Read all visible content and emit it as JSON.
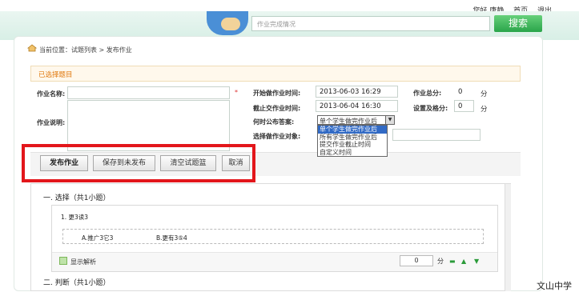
{
  "topbar": {
    "greeting": "您好,唐静",
    "home": "首页",
    "logout": "退出"
  },
  "search": {
    "placeholder": "作业完成情况",
    "button": "搜索"
  },
  "breadcrumb": "当前位置：试题列表 > 发布作业",
  "section_title": "已选择题目",
  "form": {
    "name_label": "作业名称:",
    "desc_label": "作业说明:",
    "star": "*",
    "start_label": "开始做作业时间:",
    "start_value": "2013-06-03 16:29",
    "end_label": "截止交作业时间:",
    "end_value": "2013-06-04 16:30",
    "publish_label": "何时公布答案:",
    "publish_selected": "单个学生做完作业后",
    "target_label": "选择做作业对象:",
    "total_label": "作业总分:",
    "total_value": "0",
    "pass_label": "设置及格分:",
    "pass_value": "0",
    "unit": "分"
  },
  "dropdown_options": [
    "单个学生做完作业后",
    "所有学生做完作业后",
    "提交作业截止时间",
    "自定义时间"
  ],
  "actions": {
    "publish": "发布作业",
    "save": "保存到未发布",
    "clear": "清空试题篮",
    "cancel": "取消"
  },
  "questions": {
    "section1": "一. 选择（共1小题）",
    "q1_title": "1. 更3读3",
    "q1_opt_a": "A.推广3它3",
    "q1_opt_b": "B.更有3⑤4",
    "show_analysis": "显示解析",
    "score": "0",
    "score_unit": "分",
    "section2": "二. 判断（共1小题）"
  },
  "watermark": "文山中学"
}
